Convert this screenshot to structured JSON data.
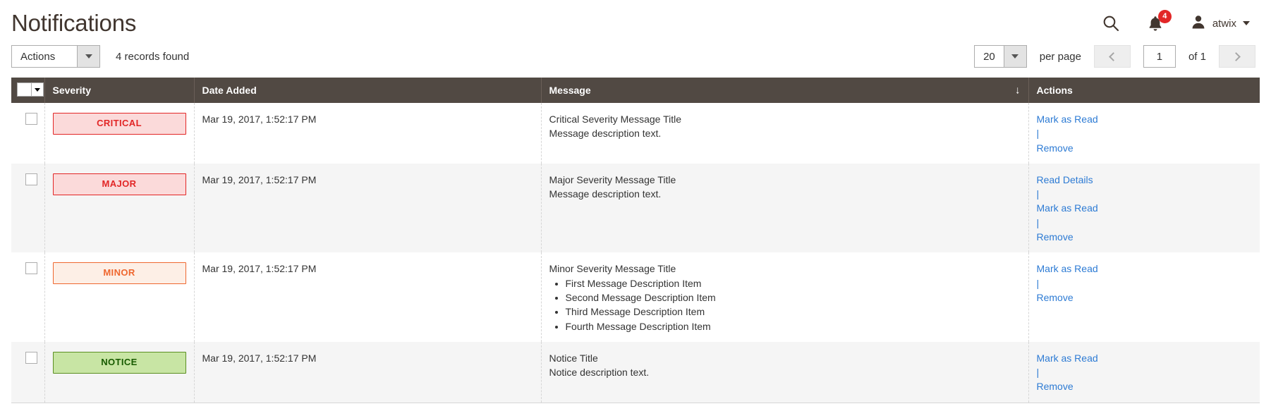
{
  "header": {
    "title": "Notifications",
    "search_icon": "search-icon",
    "notifications_icon": "bell-icon",
    "notifications_count": "4",
    "user_icon": "user-avatar-icon",
    "user_name": "atwix",
    "user_caret": "chevron-down-icon"
  },
  "toolbar": {
    "actions_label": "Actions",
    "actions_arrow": "chevron-down-icon",
    "records_found": "4 records found",
    "per_page_value": "20",
    "per_page_arrow": "chevron-down-icon",
    "per_page_label": "per page",
    "prev_icon": "chevron-left-icon",
    "next_icon": "chevron-right-icon",
    "current_page": "1",
    "of_label": "of 1"
  },
  "grid": {
    "columns": {
      "select_all": "select-all-checkbox",
      "severity": "Severity",
      "date_added": "Date Added",
      "message": "Message",
      "sort_indicator": "↓",
      "actions": "Actions"
    },
    "rows": [
      {
        "severity": "CRITICAL",
        "severity_class": "sev-critical",
        "date": "Mar 19, 2017, 1:52:17 PM",
        "message_title": "Critical Severity Message Title",
        "message_desc": "Message description text.",
        "message_items": [],
        "actions": [
          "Mark as Read",
          "Remove"
        ]
      },
      {
        "severity": "MAJOR",
        "severity_class": "sev-major",
        "date": "Mar 19, 2017, 1:52:17 PM",
        "message_title": "Major Severity Message Title",
        "message_desc": "Message description text.",
        "message_items": [],
        "actions": [
          "Read Details",
          "Mark as Read",
          "Remove"
        ]
      },
      {
        "severity": "MINOR",
        "severity_class": "sev-minor",
        "date": "Mar 19, 2017, 1:52:17 PM",
        "message_title": "Minor Severity Message Title",
        "message_desc": "",
        "message_items": [
          "First Message Description Item",
          "Second Message Description Item",
          "Third Message Description Item",
          "Fourth Message Description Item"
        ],
        "actions": [
          "Mark as Read",
          "Remove"
        ]
      },
      {
        "severity": "NOTICE",
        "severity_class": "sev-notice",
        "date": "Mar 19, 2017, 1:52:17 PM",
        "message_title": "Notice Title",
        "message_desc": "Notice description text.",
        "message_items": [],
        "actions": [
          "Mark as Read",
          "Remove"
        ]
      }
    ]
  },
  "colors": {
    "header_bar": "#514943",
    "badge_red": "#e22626",
    "link_blue": "#2d7bd4",
    "critical_bg": "#fbdada",
    "minor_border": "#ef672f",
    "notice_bg": "#c8e5a4",
    "notice_text": "#185b00",
    "row_alt": "#f5f5f5"
  }
}
